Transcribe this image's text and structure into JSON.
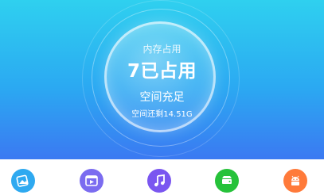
{
  "storage": {
    "caption": "内存占用",
    "used": "7已占用",
    "status": "空间充足",
    "free": "空间还剩14.51G"
  },
  "dock": {
    "items": [
      {
        "icon": "gallery-icon",
        "color": "#2ea9f0"
      },
      {
        "icon": "video-icon",
        "color": "#7b6cf0"
      },
      {
        "icon": "music-icon",
        "color": "#7a56f0"
      },
      {
        "icon": "storage-icon",
        "color": "#26c23a"
      },
      {
        "icon": "android-icon",
        "color": "#ff7a3a"
      }
    ]
  }
}
